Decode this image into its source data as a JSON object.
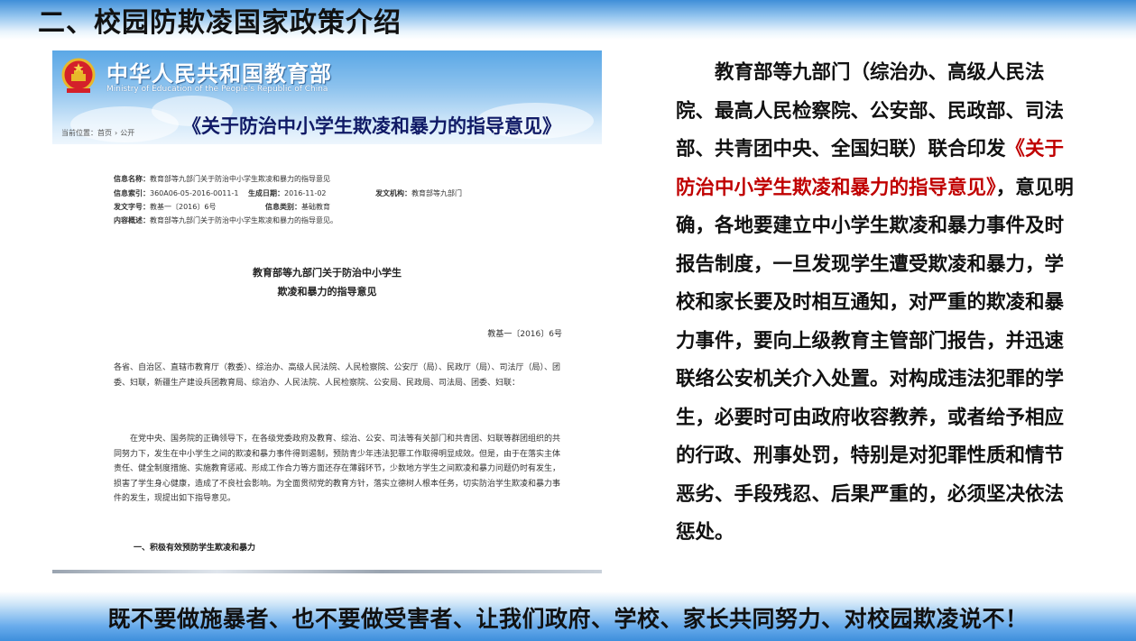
{
  "slide_title": "二、校园防欺凌国家政策介绍",
  "doc": {
    "ministry_cn": "中华人民共和国教育部",
    "ministry_en": "Ministry of Education of the People's Republic of China",
    "banner_title": "《关于防治中小学生欺凌和暴力的指导意见》",
    "breadcrumb": {
      "prefix": "当前位置：",
      "items": [
        "首页",
        "公开"
      ]
    },
    "meta": [
      {
        "label": "信息名称：",
        "value": "教育部等九部门关于防治中小学生欺凌和暴力的指导意见"
      },
      {
        "label": "信息索引：",
        "value": "360A06-05-2016-0011-1",
        "label2": "生成日期：",
        "value2": "2016-11-02",
        "label3": "发文机构：",
        "value3": "教育部等九部门"
      },
      {
        "label": "发文字号：",
        "value": "教基一〔2016〕6号",
        "label2": "信息类别：",
        "value2": "基础教育"
      },
      {
        "label": "内容概述：",
        "value": "教育部等九部门关于防治中小学生欺凌和暴力的指导意见。"
      }
    ],
    "heading_line1": "教育部等九部门关于防治中小学生",
    "heading_line2": "欺凌和暴力的指导意见",
    "doc_number": "教基一〔2016〕6号",
    "para_addressees": "各省、自治区、直辖市教育厅（教委）、综治办、高级人民法院、人民检察院、公安厅（局）、民政厅（局）、司法厅（局）、团委、妇联，新疆生产建设兵团教育局、综治办、人民法院、人民检察院、公安局、民政局、司法局、团委、妇联：",
    "para_body": "在党中央、国务院的正确领导下，在各级党委政府及教育、综治、公安、司法等有关部门和共青团、妇联等群团组织的共同努力下，发生在中小学生之间的欺凌和暴力事件得到遏制，预防青少年违法犯罪工作取得明显成效。但是，由于在落实主体责任、健全制度措施、实施教育惩戒、形成工作合力等方面还存在薄弱环节，少数地方学生之间欺凌和暴力问题仍时有发生，损害了学生身心健康，造成了不良社会影响。为全面贯彻党的教育方针，落实立德树人根本任务，切实防治学生欺凌和暴力事件的发生，现提出如下指导意见。",
    "section_heading": "一、积极有效预防学生欺凌和暴力"
  },
  "body": {
    "part1": "教育部等九部门（综治办、高级人民法院、最高人民检察院、公安部、民政部、司法部、共青团中央、全国妇联）联合印发",
    "policy_title": "《关于防治中小学生欺凌和暴力的指导意见》",
    "part2": "，意见明确，各地要建立中小学生欺凌和暴力事件及时报告制度，一旦发现学生遭受欺凌和暴力，学校和家长要及时相互通知，对严重的欺凌和暴力事件，要向上级教育主管部门报告，并迅速联络公安机关介入处置。对构成违法犯罪的学生，必要时可由政府收容教养，或者给予相应的行政、刑事处罚，特别是对犯罪性质和情节恶劣、手段残忍、后果严重的，必须坚决依法惩处。"
  },
  "slogan": "既不要做施暴者、也不要做受害者、让我们政府、学校、家长共同努力、对校园欺凌说不！",
  "colors": {
    "accent_blue": "#3e8fdc",
    "policy_red": "#c00000",
    "banner_title_navy": "#101a66"
  }
}
